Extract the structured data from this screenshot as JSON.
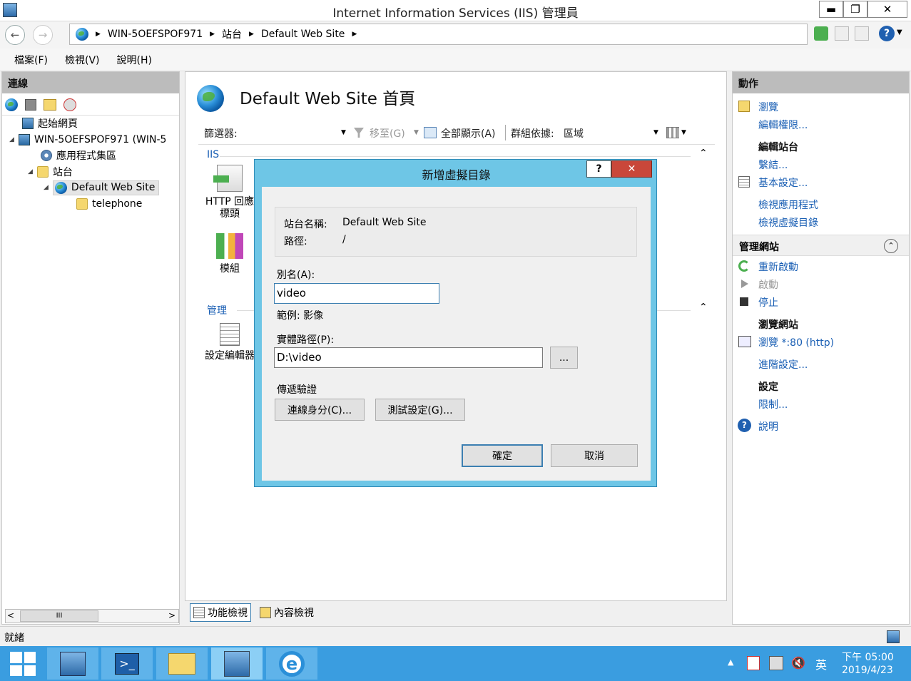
{
  "window": {
    "title": "Internet Information Services (IIS) 管理員",
    "min": "▬",
    "restore": "❐",
    "close": "✕"
  },
  "address": {
    "crumbs": [
      "WIN-5OEFSPOF971",
      "站台",
      "Default Web Site"
    ],
    "sep": "▶"
  },
  "menu": [
    "檔案(F)",
    "檢視(V)",
    "說明(H)"
  ],
  "connections": {
    "header": "連線",
    "tree": [
      {
        "label": "起始網頁",
        "icon": "start-page-icon"
      },
      {
        "label": "WIN-5OEFSPOF971 (WIN-5",
        "icon": "server-icon"
      },
      {
        "label": "應用程式集區",
        "icon": "app-pools-icon"
      },
      {
        "label": "站台",
        "icon": "sites-folder-icon"
      },
      {
        "label": "Default Web Site",
        "icon": "globe-icon"
      },
      {
        "label": "telephone",
        "icon": "folder-icon"
      }
    ],
    "scroll_mark": "III"
  },
  "center": {
    "title": "Default Web Site 首頁",
    "filter_label": "篩選器:",
    "goto": "移至(G)",
    "show_all": "全部顯示(A)",
    "group_by": "群組依據:",
    "group_value": "區域",
    "section_iis": "IIS",
    "http_label": "HTTP 回應標頭",
    "modules_label": "模組",
    "section_manage": "管理",
    "config_label": "設定編輯器",
    "tab_features": "功能檢視",
    "tab_content": "內容檢視"
  },
  "actions": {
    "header": "動作",
    "explore": "瀏覽",
    "edit_perms": "編輯權限...",
    "edit_site": "編輯站台",
    "bindings": "繫結...",
    "basic": "基本設定...",
    "view_apps": "檢視應用程式",
    "view_vdirs": "檢視虛擬目錄",
    "manage_site": "管理網站",
    "restart": "重新啟動",
    "start": "啟動",
    "stop": "停止",
    "browse_site": "瀏覽網站",
    "browse80": "瀏覽 *:80 (http)",
    "advanced": "進階設定...",
    "config": "設定",
    "limits": "限制...",
    "help": "說明"
  },
  "dialog": {
    "title": "新增虛擬目錄",
    "help": "?",
    "close": "✕",
    "site_name_label": "站台名稱:",
    "site_name_value": "Default Web Site",
    "path_label": "路徑:",
    "path_value": "/",
    "alias_label": "別名(A):",
    "alias_value": "video",
    "example": "範例: 影像",
    "physical_label": "實體路徑(P):",
    "physical_value": "D:\\video",
    "browse_btn": "...",
    "pass_auth": "傳遞驗證",
    "connect_as": "連線身分(C)...",
    "test_settings": "測試設定(G)...",
    "ok": "確定",
    "cancel": "取消"
  },
  "status": {
    "text": "就緒"
  },
  "taskbar": {
    "ime": "英",
    "time": "下午 05:00",
    "date": "2019/4/23"
  },
  "colors": {
    "dialog_frame": "#6ec6e6",
    "taskbar": "#3a9de0",
    "link": "#1a5fb4",
    "close_red": "#c9473a"
  }
}
